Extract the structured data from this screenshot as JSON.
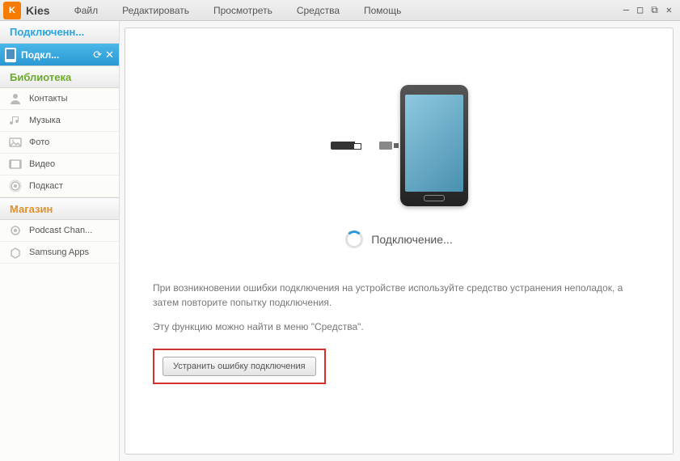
{
  "app": {
    "name": "Kies",
    "logo_text": "K"
  },
  "menu": {
    "file": "Файл",
    "edit": "Редактировать",
    "view": "Просмотреть",
    "tools": "Средства",
    "help": "Помощь"
  },
  "sidebar": {
    "connected_header": "Подключенн...",
    "active_device": "Подкл...",
    "library_header": "Библиотека",
    "library": {
      "contacts": "Контакты",
      "music": "Музыка",
      "photo": "Фото",
      "video": "Видео",
      "podcast": "Подкаст"
    },
    "store_header": "Магазин",
    "store": {
      "podcast_channels": "Podcast Chan...",
      "samsung_apps": "Samsung Apps"
    }
  },
  "main": {
    "status": "Подключение...",
    "help_line1": "При возникновении ошибки подключения на устройстве используйте средство устранения неполадок, а затем повторите попытку подключения.",
    "help_line2": "Эту функцию можно найти в меню \"Средства\".",
    "fix_button": "Устранить ошибку подключения"
  }
}
